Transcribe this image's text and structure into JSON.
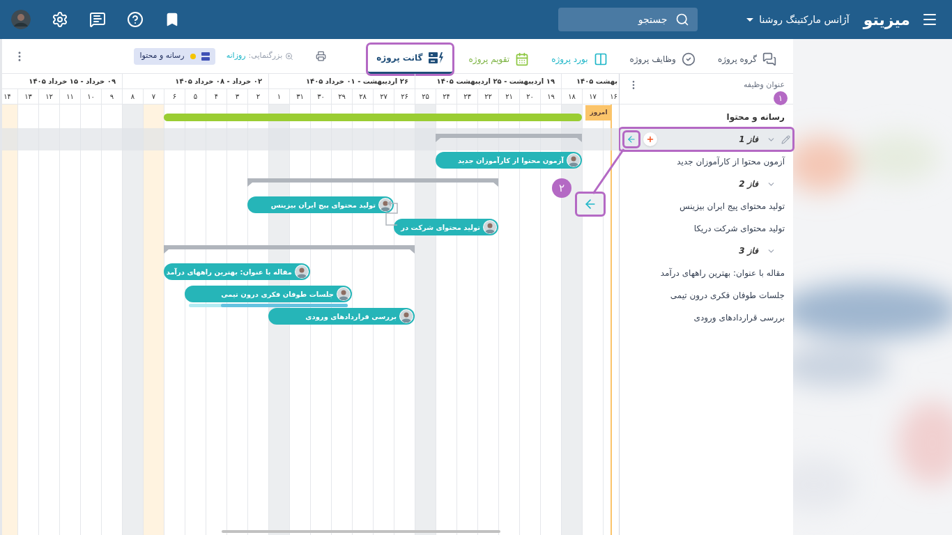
{
  "topbar": {
    "logo": "میزیتو",
    "workspace": "آژانس مارکتینگ روشنا",
    "search": {
      "placeholder": "جستجو"
    }
  },
  "tabs": [
    {
      "label": "گروه پروژه",
      "selected": false,
      "highlighted": false
    },
    {
      "label": "وظایف پروژه",
      "selected": false,
      "highlighted": false
    },
    {
      "label": "بورد پروژه",
      "selected": false,
      "highlighted": false
    },
    {
      "label": "تقویم پروژه",
      "selected": false,
      "highlighted": false
    },
    {
      "label": "گانت پروژه",
      "selected": true,
      "highlighted": true
    }
  ],
  "zoom": {
    "label": "بزرگنمایی:",
    "value": "روزانه"
  },
  "project_chip": {
    "label": "رسانه و محتوا",
    "color": "#f5c400"
  },
  "task_panel": {
    "header": "عنوان وظیفه"
  },
  "timeline": {
    "today_label": "امروز",
    "weeks": [
      {
        "label": "بهشت ۱۴۰۵",
        "days": [
          {
            "label": "۱۶",
            "kind": "today"
          },
          {
            "label": "۱۷",
            "kind": "normal"
          },
          {
            "label": "۱۸",
            "kind": "weekend"
          }
        ]
      },
      {
        "label": "۱۹ اردیبهشت - ۲۵ اردیبهشت ۱۴۰۵",
        "days": [
          {
            "label": "۱۹",
            "kind": "normal"
          },
          {
            "label": "۲۰",
            "kind": "normal"
          },
          {
            "label": "۲۱",
            "kind": "normal"
          },
          {
            "label": "۲۲",
            "kind": "normal"
          },
          {
            "label": "۲۳",
            "kind": "normal"
          },
          {
            "label": "۲۴",
            "kind": "normal"
          },
          {
            "label": "۲۵",
            "kind": "weekend"
          }
        ]
      },
      {
        "label": "۲۶ اردیبهشت - ۰۱ خرداد ۱۴۰۵",
        "days": [
          {
            "label": "۲۶",
            "kind": "normal"
          },
          {
            "label": "۲۷",
            "kind": "normal"
          },
          {
            "label": "۲۸",
            "kind": "normal"
          },
          {
            "label": "۲۹",
            "kind": "normal"
          },
          {
            "label": "۳۰",
            "kind": "normal"
          },
          {
            "label": "۳۱",
            "kind": "normal"
          },
          {
            "label": "۱",
            "kind": "weekend"
          }
        ]
      },
      {
        "label": "۰۲ خرداد - ۰۸ خرداد ۱۴۰۵",
        "days": [
          {
            "label": "۲",
            "kind": "normal"
          },
          {
            "label": "۳",
            "kind": "normal"
          },
          {
            "label": "۴",
            "kind": "normal"
          },
          {
            "label": "۵",
            "kind": "normal"
          },
          {
            "label": "۶",
            "kind": "normal"
          },
          {
            "label": "۷",
            "kind": "holiday"
          },
          {
            "label": "۸",
            "kind": "weekend"
          }
        ]
      },
      {
        "label": "۰۹ خرداد - ۱۵ خرداد ۱۴۰۵",
        "days": [
          {
            "label": "۹",
            "kind": "normal"
          },
          {
            "label": "۱۰",
            "kind": "normal"
          },
          {
            "label": "۱۱",
            "kind": "normal"
          },
          {
            "label": "۱۲",
            "kind": "normal"
          },
          {
            "label": "۱۳",
            "kind": "normal"
          },
          {
            "label": "۱۴",
            "kind": "holiday"
          }
        ]
      }
    ]
  },
  "project": {
    "title": "رسانه و محتوا",
    "selected": false,
    "children": [
      {
        "title": "فاز 1",
        "selected": true,
        "highlighted": true,
        "expanded": true,
        "children": [
          {
            "title": "آزمون محتوا از کارآموزان جدید",
            "bar_title": "آزمون محتوا از کارآموزان جدید",
            "selected": false,
            "linked_to_previous": false
          }
        ]
      },
      {
        "title": "فاز 2",
        "selected": false,
        "highlighted": false,
        "expanded": true,
        "children": [
          {
            "title": "تولید محتوای پیج ایران بیزینس",
            "bar_title": "تولید محتوای پیج ایران بیزینس",
            "selected": false,
            "linked_to_previous": false
          },
          {
            "title": "تولید محتوای شرکت دریکا",
            "bar_title": "تولید محتوای شرکت در",
            "selected": false,
            "linked_to_previous": true
          }
        ]
      },
      {
        "title": "فاز 3",
        "selected": false,
        "highlighted": false,
        "expanded": true,
        "children": [
          {
            "title": "مقاله با عنوان: بهترین راههای درآمد",
            "bar_title": "مقاله با عنوان: بهترین راههای درآمد",
            "selected": false,
            "linked_to_previous": false
          },
          {
            "title": "جلسات طوفان فکری درون تیمی",
            "bar_title": "جلسات طوفان فکری درون تیمی",
            "selected": false,
            "level": 0.8,
            "linked_to_previous": false
          },
          {
            "title": "بررسی قراردادهای ورودی",
            "bar_title": "بررسی قراردادهای ورودی",
            "selected": false,
            "linked_to_previous": false
          }
        ]
      }
    ]
  },
  "annotations": [
    "۱",
    "۲"
  ]
}
